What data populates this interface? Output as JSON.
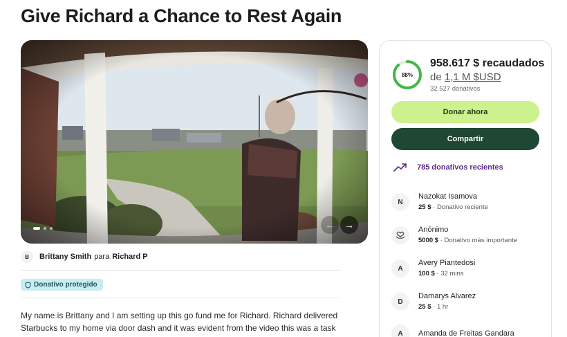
{
  "title": "Give Richard a Chance to Rest Again",
  "media": {
    "dots": 3,
    "prev_icon": "←",
    "next_icon": "→"
  },
  "organizer": {
    "avatar": "B",
    "name": "Brittany Smith",
    "connector": "para",
    "beneficiary": "Richard P"
  },
  "badge": {
    "label": "Donativo protegido"
  },
  "story": "My name is Brittany and I am setting up this go fund me for Richard. Richard delivered Starbucks to my home via door dash and it was evident from the video this was a task for",
  "panel": {
    "progress_pct": 88,
    "progress_label": "88%",
    "raised": "958.617 $ recaudados",
    "goal_prefix": "de",
    "goal_amount": "1,1 M $USD",
    "count": "32.527 donativos",
    "donate_label": "Donar ahora",
    "share_label": "Compartir",
    "recent_label": "785 donativos recientes",
    "colors": {
      "progress": "#43b649",
      "donate_bg": "#cdf28d",
      "share_bg": "#1f4733",
      "recent": "#5b2a86"
    }
  },
  "donors": [
    {
      "avatar": "N",
      "name": "Nazokat Isamova",
      "amount": "25 $",
      "note": "Donativo reciente"
    },
    {
      "avatar": "heart-hands-icon",
      "name": "Anónimo",
      "amount": "5000 $",
      "note": "Donativo más importante"
    },
    {
      "avatar": "A",
      "name": "Avery Piantedosi",
      "amount": "100 $",
      "note": "32 mins"
    },
    {
      "avatar": "D",
      "name": "Damarys Alvarez",
      "amount": "25 $",
      "note": "1 hr"
    },
    {
      "avatar": "A",
      "name": "Amanda de Freitas Gandara",
      "amount": "",
      "note": ""
    }
  ]
}
